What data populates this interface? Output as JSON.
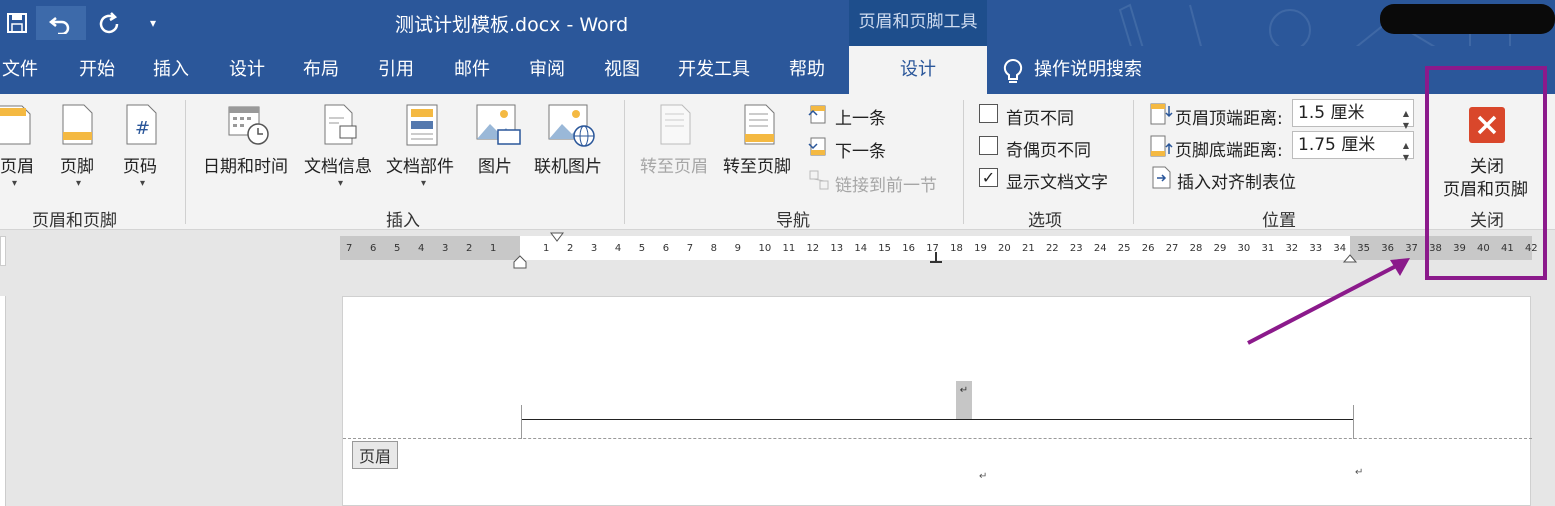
{
  "window": {
    "title": "测试计划模板.docx  -  Word",
    "context_tab_group": "页眉和页脚工具"
  },
  "quick_access": {
    "save_icon": "save-icon",
    "undo_icon": "undo-icon",
    "redo_icon": "redo-icon",
    "customize_icon": "customize-qat-icon"
  },
  "tabs": [
    "文件",
    "开始",
    "插入",
    "设计",
    "布局",
    "引用",
    "邮件",
    "审阅",
    "视图",
    "开发工具",
    "帮助",
    "设计"
  ],
  "tell_me": "操作说明搜索",
  "ribbon": {
    "header_footer": {
      "header": "页眉",
      "footer": "页脚",
      "page_number": "页码",
      "group": "页眉和页脚"
    },
    "insert": {
      "datetime": "日期和时间",
      "docinfo": "文档信息",
      "quickparts": "文档部件",
      "picture": "图片",
      "online_picture": "联机图片",
      "group": "插入"
    },
    "navigation": {
      "goto_header": "转至页眉",
      "goto_footer": "转至页脚",
      "previous": "上一条",
      "next": "下一条",
      "link_previous": "链接到前一节",
      "group": "导航"
    },
    "options": {
      "different_first": "首页不同",
      "different_odd_even": "奇偶页不同",
      "show_doc_text": "显示文档文字",
      "show_doc_text_checked": true,
      "group": "选项"
    },
    "position": {
      "header_top_label": "页眉顶端距离:",
      "header_top_value": "1.5 厘米",
      "footer_bottom_label": "页脚底端距离:",
      "footer_bottom_value": "1.75 厘米",
      "insert_align_tab": "插入对齐制表位",
      "group": "位置"
    },
    "close": {
      "line1": "关闭",
      "line2": "页眉和页脚",
      "group": "关闭"
    }
  },
  "ruler": {
    "left": [
      "7",
      "6",
      "5",
      "4",
      "3",
      "2",
      "1"
    ],
    "right": [
      "1",
      "2",
      "3",
      "4",
      "5",
      "6",
      "7",
      "8",
      "9",
      "10",
      "11",
      "12",
      "13",
      "14",
      "15",
      "16",
      "17",
      "18",
      "19",
      "20",
      "21",
      "22",
      "23",
      "24",
      "25",
      "26",
      "27",
      "28",
      "29",
      "30",
      "31",
      "32",
      "33",
      "34",
      "35",
      "36",
      "37",
      "38",
      "39",
      "40",
      "41",
      "42"
    ]
  },
  "document": {
    "header_tag": "页眉",
    "para_mark": "↵"
  },
  "colors": {
    "brand": "#2b579a",
    "annotation": "#8b1a8b",
    "close_red": "#d9472b"
  }
}
